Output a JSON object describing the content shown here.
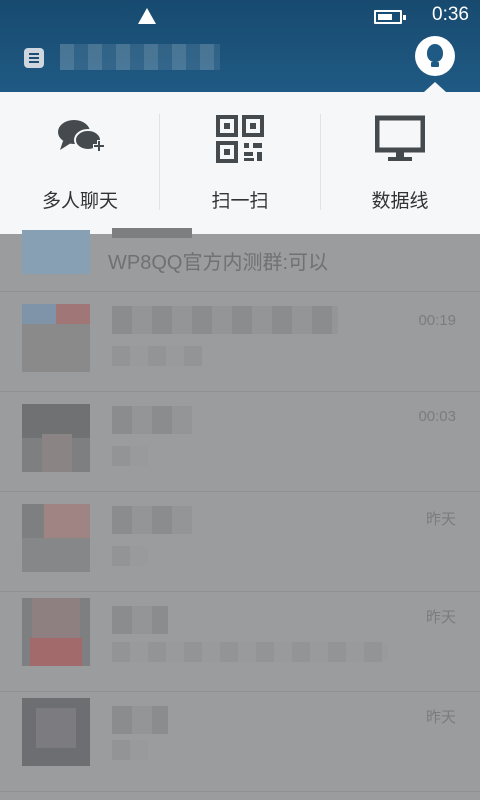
{
  "status_bar": {
    "time": "0:36"
  },
  "popup": {
    "items": [
      {
        "label": "多人聊天",
        "icon": "group-chat-add-icon"
      },
      {
        "label": "扫一扫",
        "icon": "qr-code-icon"
      },
      {
        "label": "数据线",
        "icon": "monitor-icon"
      }
    ]
  },
  "chats": {
    "group": {
      "subtitle": "WP8QQ官方内测群:可以"
    },
    "rows": [
      {
        "time": "00:19"
      },
      {
        "time": "00:03"
      },
      {
        "time": "昨天"
      },
      {
        "time": "昨天"
      },
      {
        "time": "昨天"
      }
    ]
  },
  "colors": {
    "header": "#1f5a84",
    "popup_bg": "#f6f7f8",
    "icon": "#454a4f",
    "overlay": "#9a9c9e"
  }
}
